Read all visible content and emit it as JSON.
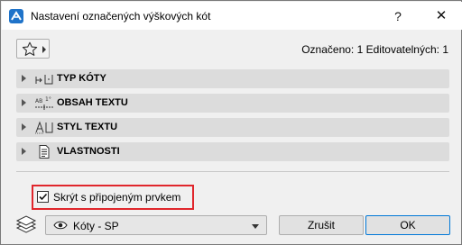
{
  "window": {
    "title": "Nastavení označených výškových kót",
    "help_label": "?",
    "close_label": "✕"
  },
  "toolbar": {
    "favorites_icon": "star-icon",
    "selection_info": "Označeno: 1 Editovatelných: 1"
  },
  "panels": [
    {
      "label": "TYP KÓTY",
      "icon": "dimension-type-icon"
    },
    {
      "label": "OBSAH TEXTU",
      "icon": "text-content-icon"
    },
    {
      "label": "STYL TEXTU",
      "icon": "text-style-icon"
    },
    {
      "label": "VLASTNOSTI",
      "icon": "properties-icon"
    }
  ],
  "options": {
    "hide_with_linked_label": "Skrýt s připojeným prvkem",
    "hide_with_linked_checked": true
  },
  "footer": {
    "layer_value": "Kóty - SP",
    "cancel_label": "Zrušit",
    "ok_label": "OK"
  },
  "colors": {
    "highlight": "#e0262c",
    "panel_bg": "#dcdcdc",
    "app_icon": "#1f73c9"
  }
}
